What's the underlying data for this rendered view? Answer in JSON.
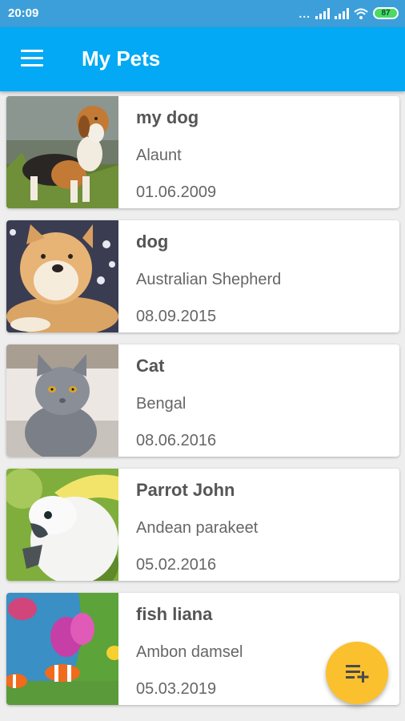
{
  "status_bar": {
    "time": "20:09",
    "dots": "...",
    "battery": "87",
    "icons": [
      "signal-icon",
      "signal-icon",
      "wifi-icon",
      "battery-icon"
    ]
  },
  "app_bar": {
    "title": "My Pets",
    "menu_icon": "menu-icon"
  },
  "pets": [
    {
      "name": "my dog",
      "breed": "Alaunt",
      "date": "01.06.2009",
      "photo": "beagle-photo"
    },
    {
      "name": "dog",
      "breed": "Australian Shepherd",
      "date": "08.09.2015",
      "photo": "akita-photo"
    },
    {
      "name": "Cat",
      "breed": "Bengal",
      "date": "08.06.2016",
      "photo": "gray-cat-photo"
    },
    {
      "name": "Parrot John",
      "breed": "Andean parakeet",
      "date": "05.02.2016",
      "photo": "cockatoo-photo"
    },
    {
      "name": "fish liana",
      "breed": "Ambon damsel",
      "date": "05.03.2019",
      "photo": "clownfish-photo"
    }
  ],
  "fab": {
    "icon": "playlist-add-icon"
  },
  "colors": {
    "status_bar": "#3d9fda",
    "app_bar": "#03a9f4",
    "fab": "#fbc02d",
    "background": "#eeeeee"
  }
}
